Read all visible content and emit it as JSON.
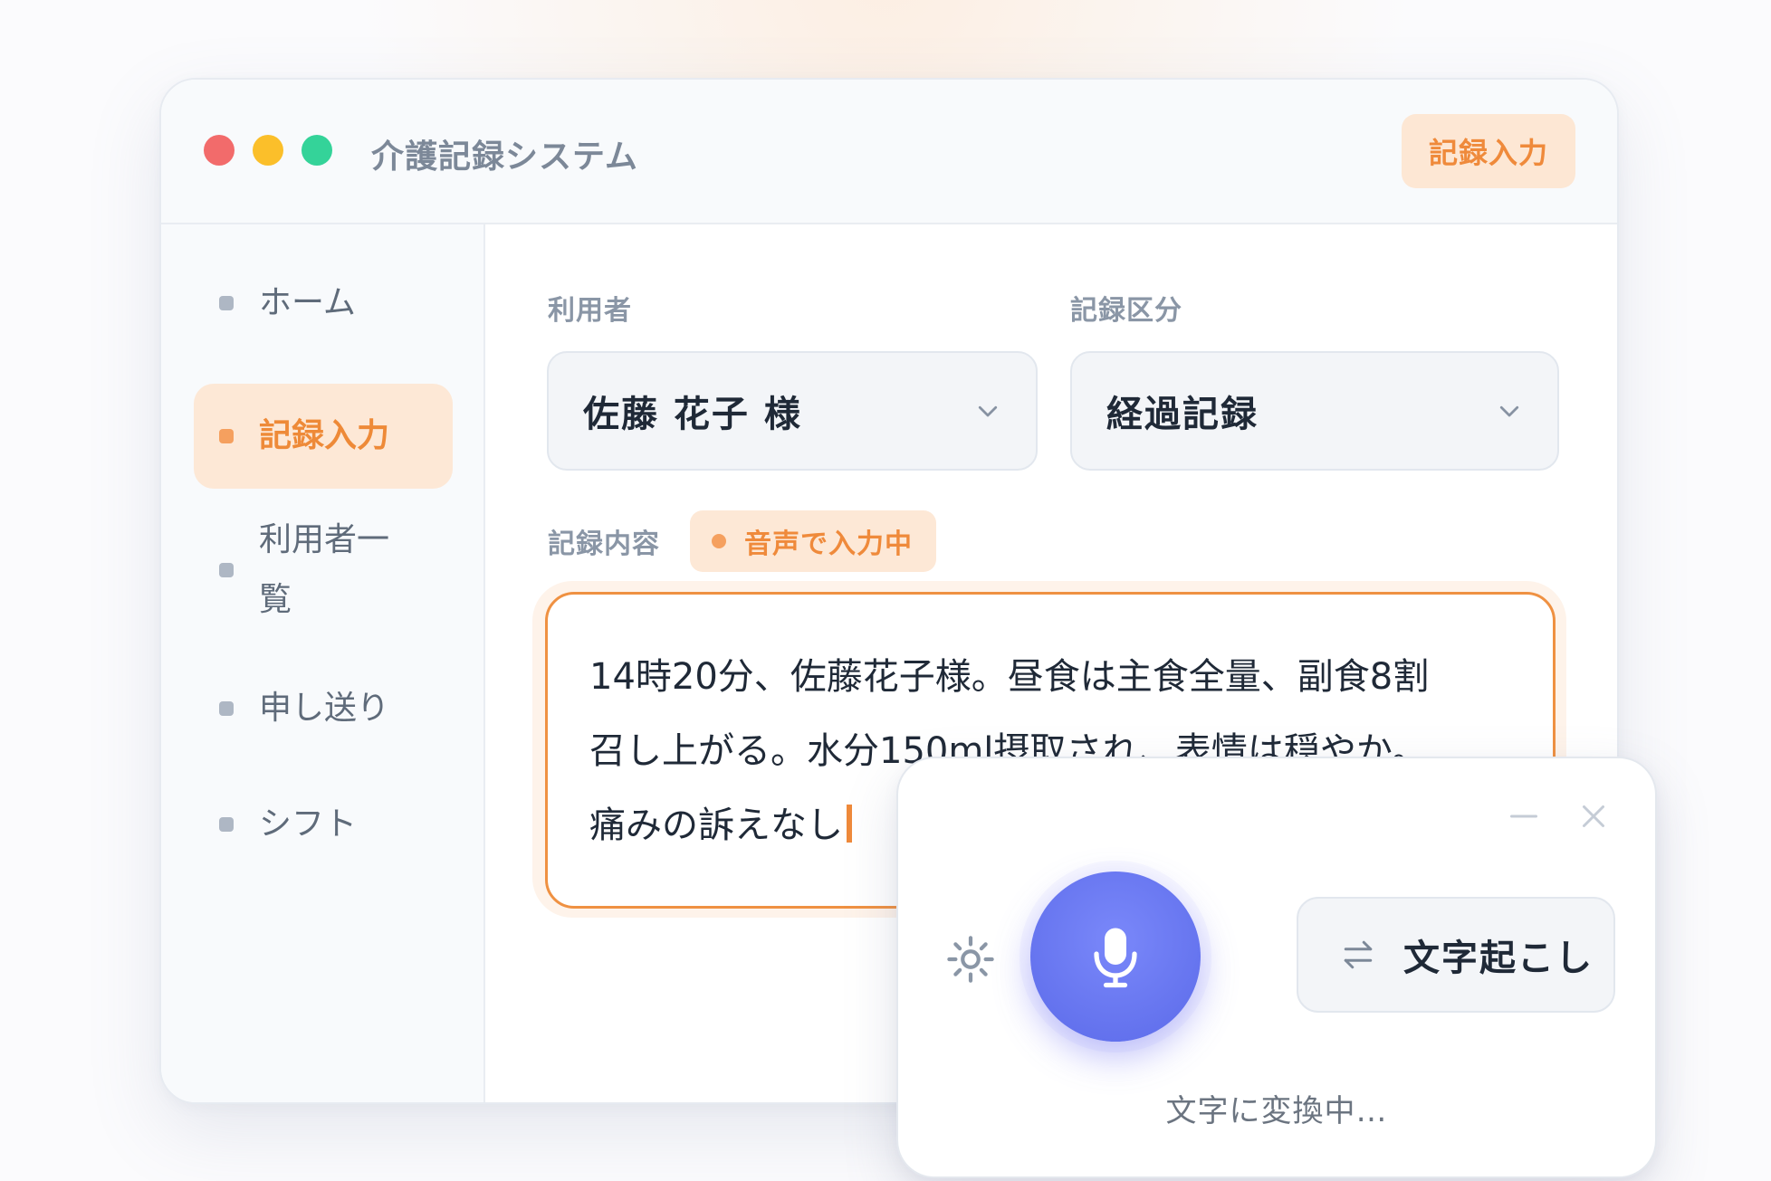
{
  "window": {
    "title": "介護記録システム",
    "header_button": "記録入力"
  },
  "sidebar": {
    "items": [
      {
        "label": "ホーム",
        "active": false
      },
      {
        "label": "記録入力",
        "active": true
      },
      {
        "label": "利用者一覧",
        "active": false
      },
      {
        "label": "申し送り",
        "active": false
      },
      {
        "label": "シフト",
        "active": false
      }
    ]
  },
  "form": {
    "user_label": "利用者",
    "user_value": "佐藤 花子 様",
    "category_label": "記録区分",
    "category_value": "経過記録",
    "content_label": "記録内容",
    "status_badge": "音声で入力中",
    "content_lines": [
      "14時20分、佐藤花子様。昼食は主食全量、副食8割",
      "召し上がる。水分150ml摂取され、表情は穏やか。",
      "痛みの訴えなし"
    ]
  },
  "voice_panel": {
    "transcribe_button": "文字起こし",
    "status": "文字に変換中…",
    "icons": [
      "minimize-icon",
      "close-icon",
      "settings-icon",
      "microphone-icon",
      "swap-arrows-icon"
    ]
  },
  "colors": {
    "accent_orange": "#ef8a3b",
    "accent_orange_soft": "#fde8d6",
    "mic_blue": "#5b6ae9",
    "traffic_red": "#f26b6b",
    "traffic_yellow": "#fbbf2a",
    "traffic_green": "#34d399"
  }
}
